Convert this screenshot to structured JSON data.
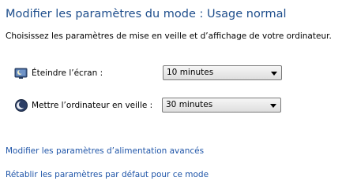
{
  "header": {
    "title": "Modifier les paramètres du mode : Usage normal",
    "subtitle": "Choisissez les paramètres de mise en veille et d’affichage de votre ordinateur."
  },
  "settings": [
    {
      "label": "Éteindre l’écran :",
      "value": "10 minutes",
      "icon": "display-moon-icon"
    },
    {
      "label": "Mettre l’ordinateur en veille :",
      "value": "30 minutes",
      "icon": "sleep-moon-icon"
    }
  ],
  "links": {
    "advanced": "Modifier les paramètres d’alimentation avancés",
    "restore": "Rétablir les paramètres par défaut pour ce mode"
  },
  "colors": {
    "title": "#1e4e8c",
    "link": "#1f55a8"
  }
}
